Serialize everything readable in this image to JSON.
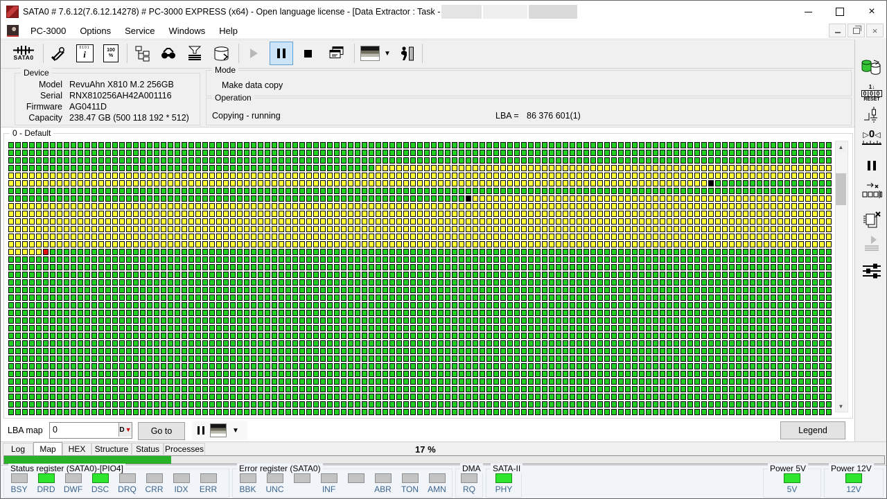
{
  "titlebar": {
    "title": "SATA0 # 7.6.12(7.6.12.14278) # PC-3000 EXPRESS (x64) - Open language license - [Data Extractor : Task - "
  },
  "menu": {
    "items": [
      "PC-3000",
      "Options",
      "Service",
      "Windows",
      "Help"
    ]
  },
  "toolbar": {
    "sata0_label": "SATA0",
    "buttons": [
      "sata0",
      "tools",
      "script-info",
      "percent-doc",
      "tree",
      "search",
      "filter",
      "database",
      "play",
      "pause",
      "stop",
      "cascade",
      "map-view",
      "map-view-dropdown",
      "exit"
    ],
    "active_button": "pause",
    "disabled_button": "play"
  },
  "right_toolbar": {
    "buttons": [
      "data-copy",
      "reset-counter",
      "test-point",
      "zero-gauge",
      "pause",
      "relocate",
      "remove-copies",
      "start-disabled",
      "sliders"
    ]
  },
  "device": {
    "group_label": "Device",
    "rows": [
      {
        "label": "Model",
        "value": "RevuAhn X810 M.2 256GB"
      },
      {
        "label": "Serial",
        "value": "RNX810256AH42A001116"
      },
      {
        "label": "Firmware",
        "value": "AG0411D"
      },
      {
        "label": "Capacity",
        "value": "238.47 GB (500 118 192 * 512)"
      }
    ]
  },
  "mode": {
    "group_label": "Mode",
    "value": "Make data copy"
  },
  "operation": {
    "group_label": "Operation",
    "status": "Copying - running",
    "lba_label": "LBA =",
    "lba_value": "86 376 601(1)"
  },
  "map": {
    "group_label": "0 - Default",
    "cols": 119,
    "colors": {
      "G": "#21cf21",
      "Y": "#ffff38",
      "K": "#000000",
      "R": "#e01010"
    },
    "rows": [
      [
        [
          "G",
          119
        ]
      ],
      [
        [
          "G",
          119
        ]
      ],
      [
        [
          "G",
          119
        ]
      ],
      [
        [
          "G",
          53
        ],
        [
          "Y",
          66
        ]
      ],
      [
        [
          "Y",
          119
        ]
      ],
      [
        [
          "Y",
          101
        ],
        [
          "K",
          1
        ],
        [
          "G",
          17
        ]
      ],
      [
        [
          "G",
          119
        ]
      ],
      [
        [
          "G",
          66
        ],
        [
          "K",
          1
        ],
        [
          "Y",
          52
        ]
      ],
      [
        [
          "Y",
          119
        ]
      ],
      [
        [
          "Y",
          119
        ]
      ],
      [
        [
          "Y",
          119
        ]
      ],
      [
        [
          "Y",
          119
        ]
      ],
      [
        [
          "Y",
          119
        ]
      ],
      [
        [
          "Y",
          119
        ]
      ],
      [
        [
          "Y",
          5
        ],
        [
          "R",
          1
        ],
        [
          "G",
          113
        ]
      ],
      [
        [
          "G",
          119
        ]
      ],
      [
        [
          "G",
          119
        ]
      ],
      [
        [
          "G",
          119
        ]
      ],
      [
        [
          "G",
          119
        ]
      ],
      [
        [
          "G",
          119
        ]
      ],
      [
        [
          "G",
          119
        ]
      ],
      [
        [
          "G",
          119
        ]
      ],
      [
        [
          "G",
          119
        ]
      ],
      [
        [
          "G",
          119
        ]
      ],
      [
        [
          "G",
          119
        ]
      ],
      [
        [
          "G",
          119
        ]
      ],
      [
        [
          "G",
          119
        ]
      ],
      [
        [
          "G",
          119
        ]
      ],
      [
        [
          "G",
          119
        ]
      ],
      [
        [
          "G",
          119
        ]
      ],
      [
        [
          "G",
          119
        ]
      ],
      [
        [
          "G",
          119
        ]
      ],
      [
        [
          "G",
          119
        ]
      ],
      [
        [
          "G",
          119
        ]
      ],
      [
        [
          "G",
          119
        ]
      ],
      [
        [
          "G",
          119
        ]
      ]
    ]
  },
  "lba_bar": {
    "label": "LBA map",
    "input_value": "0",
    "input_button": "D",
    "goto_label": "Go to",
    "legend_label": "Legend"
  },
  "tabs": {
    "items": [
      "Log",
      "Map",
      "HEX",
      "Structure",
      "Status",
      "Processes"
    ],
    "active": "Map"
  },
  "progress": {
    "label": "17 %",
    "bar_percent": 19
  },
  "status_panel": {
    "groups": [
      {
        "id": "status",
        "label": "Status register (SATA0)-[PIO4]",
        "leds": [
          {
            "label": "BSY",
            "on": false
          },
          {
            "label": "DRD",
            "on": true
          },
          {
            "label": "DWF",
            "on": false
          },
          {
            "label": "DSC",
            "on": true
          },
          {
            "label": "DRQ",
            "on": false
          },
          {
            "label": "CRR",
            "on": false
          },
          {
            "label": "IDX",
            "on": false
          },
          {
            "label": "ERR",
            "on": false
          }
        ]
      },
      {
        "id": "error",
        "label": "Error register (SATA0)",
        "leds": [
          {
            "label": "BBK",
            "on": false
          },
          {
            "label": "UNC",
            "on": false
          },
          {
            "label": "",
            "on": false
          },
          {
            "label": "INF",
            "on": false
          },
          {
            "label": "",
            "on": false
          },
          {
            "label": "ABR",
            "on": false
          },
          {
            "label": "TON",
            "on": false
          },
          {
            "label": "AMN",
            "on": false
          }
        ]
      },
      {
        "id": "dma",
        "label": "DMA",
        "leds": [
          {
            "label": "RQ",
            "on": false
          }
        ]
      },
      {
        "id": "sata2",
        "label": "SATA-II",
        "leds": [
          {
            "label": "PHY",
            "on": true
          }
        ]
      },
      {
        "id": "power5",
        "label": "Power 5V",
        "leds": [
          {
            "label": "5V",
            "on": true
          }
        ]
      },
      {
        "id": "power12",
        "label": "Power 12V",
        "leds": [
          {
            "label": "12V",
            "on": true
          }
        ]
      }
    ],
    "led_on_color": "#2ee62e",
    "led_off_color": "#c3c3c3",
    "label_color": "#3a628c"
  }
}
